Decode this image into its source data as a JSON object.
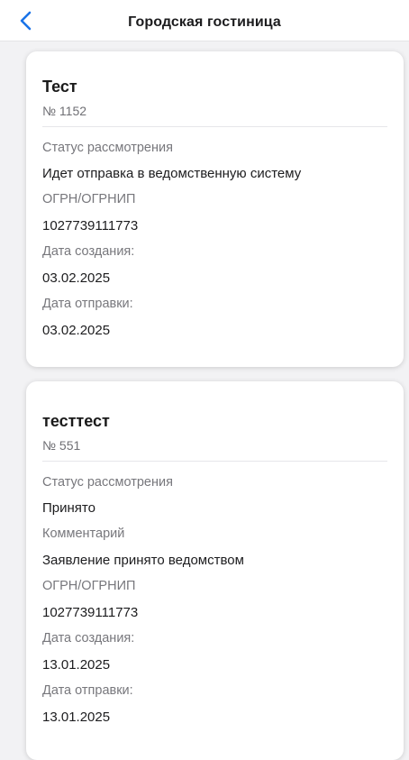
{
  "header": {
    "title": "Городская гостиница",
    "back_icon": "chevron-left-icon",
    "accent_color": "#1a73e8"
  },
  "cards": [
    {
      "title": "Тест",
      "number": "№ 1152",
      "fields": [
        {
          "label": "Статус рассмотрения",
          "value": "Идет отправка в ведомственную систему"
        },
        {
          "label": "ОГРН/ОГРНИП",
          "value": "1027739111773"
        },
        {
          "label": "Дата создания:",
          "value": "03.02.2025"
        },
        {
          "label": "Дата отправки:",
          "value": "03.02.2025"
        }
      ]
    },
    {
      "title": "тесттест",
      "number": "№ 551",
      "fields": [
        {
          "label": "Статус рассмотрения",
          "value": "Принято"
        },
        {
          "label": "Комментарий",
          "value": "Заявление принято ведомством"
        },
        {
          "label": "ОГРН/ОГРНИП",
          "value": "1027739111773"
        },
        {
          "label": "Дата создания:",
          "value": "13.01.2025"
        },
        {
          "label": "Дата отправки:",
          "value": "13.01.2025"
        }
      ]
    }
  ]
}
